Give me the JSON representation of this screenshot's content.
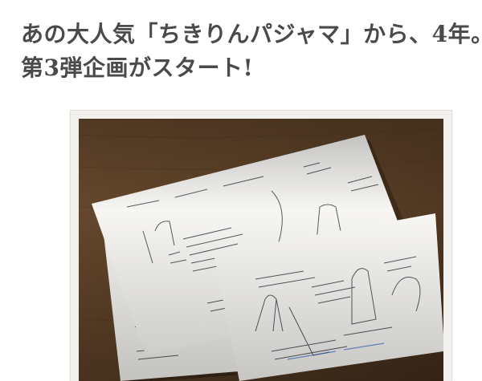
{
  "headline": {
    "line1": "あの大人気「ちきりんパジャマ」から、4年。",
    "line2": "第3弾企画がスタート!"
  },
  "photo": {
    "subject": "hand-drawn pajama design sketches on paper sheets",
    "surface_color": "#5a3f26",
    "paper_color": "#f7f6f3",
    "ink_color": "#2e3440"
  }
}
